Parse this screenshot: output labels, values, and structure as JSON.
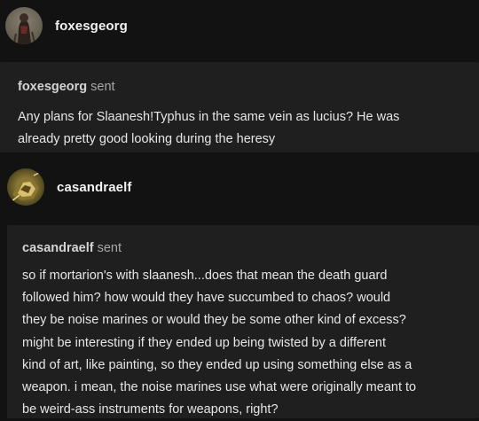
{
  "ask_1": {
    "avatar_icon": "profile-avatar-dark-figure",
    "username": "foxesgeorg",
    "sender": "foxesgeorg",
    "sent_label": "sent",
    "message": "Any plans for Slaanesh!Typhus in the same vein as lucius? He was\nalready pretty good looking during the heresy"
  },
  "ask_2": {
    "avatar_icon": "profile-avatar-gold-figure",
    "username": "casandraelf",
    "sender": "casandraelf",
    "sent_label": "sent",
    "message": "so if mortarion's with slaanesh...does that mean the death guard\nfollowed him? how would they have succumbed to chaos? would\nthey be noise marines or would they be some other kind of excess?\nmight be interesting if they ended up being twisted by a different\nkind of art, like painting, so they ended up using something else as a\nweapon. i mean, the noise marines use what were originally meant to\nbe weird-ass instruments for weapons, right?"
  },
  "colors": {
    "background": "#121212",
    "card": "#1f1f1f",
    "text": "#e6e6e6"
  }
}
